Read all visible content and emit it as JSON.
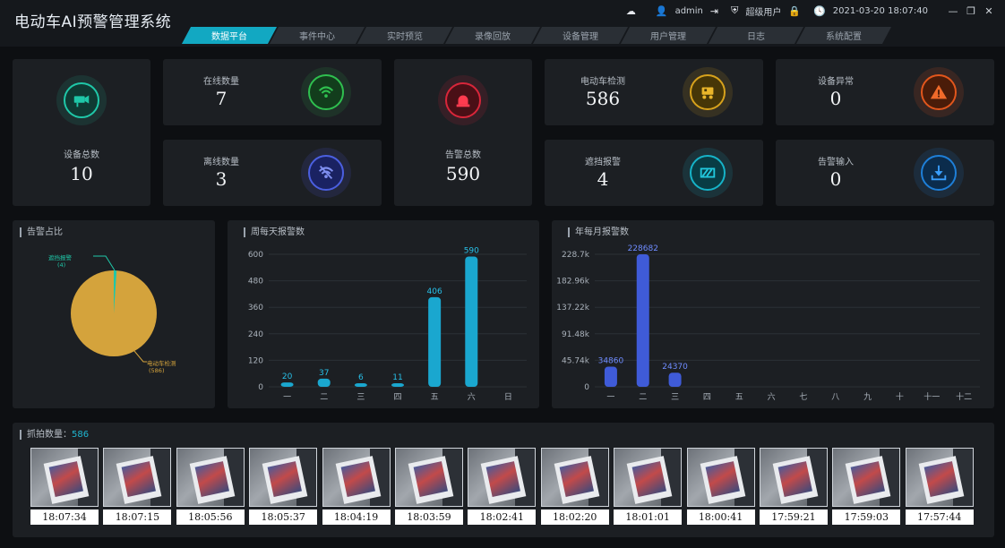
{
  "app": {
    "title": "电动车AI预警管理系统"
  },
  "status_bar": {
    "user": "admin",
    "role": "超级用户",
    "datetime": "2021-03-20 18:07:40"
  },
  "tabs": [
    {
      "label": "数据平台",
      "active": true
    },
    {
      "label": "事件中心",
      "active": false
    },
    {
      "label": "实时预览",
      "active": false
    },
    {
      "label": "录像回放",
      "active": false
    },
    {
      "label": "设备管理",
      "active": false
    },
    {
      "label": "用户管理",
      "active": false
    },
    {
      "label": "日志",
      "active": false
    },
    {
      "label": "系统配置",
      "active": false
    }
  ],
  "stats": {
    "device_total": {
      "label": "设备总数",
      "value": "10",
      "icon": "camera-icon",
      "color": "#1fc7a8"
    },
    "online": {
      "label": "在线数量",
      "value": "7",
      "icon": "wifi-icon",
      "color": "#2fbf4f"
    },
    "offline": {
      "label": "离线数量",
      "value": "3",
      "icon": "wifi-off-icon",
      "color": "#4b5fe0"
    },
    "alarm_total": {
      "label": "告警总数",
      "value": "590",
      "icon": "alarm-siren-icon",
      "color": "#d8263a"
    },
    "ebike_detect": {
      "label": "电动车检测",
      "value": "586",
      "icon": "ebike-icon",
      "color": "#d7a21c"
    },
    "device_abnormal": {
      "label": "设备异常",
      "value": "0",
      "icon": "warning-icon",
      "color": "#e2561c"
    },
    "occlusion": {
      "label": "遮挡报警",
      "value": "4",
      "icon": "occlusion-icon",
      "color": "#16b3c8"
    },
    "alarm_import": {
      "label": "告警输入",
      "value": "0",
      "icon": "download-icon",
      "color": "#1e7fd8"
    }
  },
  "pie_panel": {
    "title": "告警占比",
    "slices": [
      {
        "label": "遮挡报警",
        "sub": "(4)",
        "value": 4,
        "color": "#1fc7a8"
      },
      {
        "label": "电动车检测",
        "sub": "(586)",
        "value": 586,
        "color": "#d4a33c"
      }
    ]
  },
  "week_panel": {
    "title": "周每天报警数",
    "chart_data": {
      "type": "bar",
      "categories": [
        "一",
        "二",
        "三",
        "四",
        "五",
        "六",
        "日"
      ],
      "values": [
        20,
        37,
        6,
        11,
        406,
        590,
        0
      ],
      "value_labels": [
        "20",
        "37",
        "6",
        "11",
        "406",
        "590",
        ""
      ],
      "ylim": [
        0,
        600
      ],
      "yticks": [
        "0",
        "120",
        "240",
        "360",
        "480",
        "600"
      ],
      "color": "#1aa7cf"
    }
  },
  "month_panel": {
    "title": "年每月报警数",
    "chart_data": {
      "type": "bar",
      "categories": [
        "一",
        "二",
        "三",
        "四",
        "五",
        "六",
        "七",
        "八",
        "九",
        "十",
        "十一",
        "十二"
      ],
      "values": [
        34860,
        228682,
        24370,
        0,
        0,
        0,
        0,
        0,
        0,
        0,
        0,
        0
      ],
      "value_labels": [
        "34860",
        "228682",
        "24370",
        "",
        "",
        "",
        "",
        "",
        "",
        "",
        "",
        ""
      ],
      "ylim": [
        0,
        228700
      ],
      "yticks": [
        "0",
        "45.74k",
        "91.48k",
        "137.22k",
        "182.96k",
        "228.7k"
      ],
      "color": "#3f5bd8"
    }
  },
  "captures": {
    "label": "抓拍数量：",
    "count": "586",
    "times": [
      "18:07:34",
      "18:07:15",
      "18:05:56",
      "18:05:37",
      "18:04:19",
      "18:03:59",
      "18:02:41",
      "18:02:20",
      "18:01:01",
      "18:00:41",
      "17:59:21",
      "17:59:03",
      "17:57:44"
    ]
  }
}
